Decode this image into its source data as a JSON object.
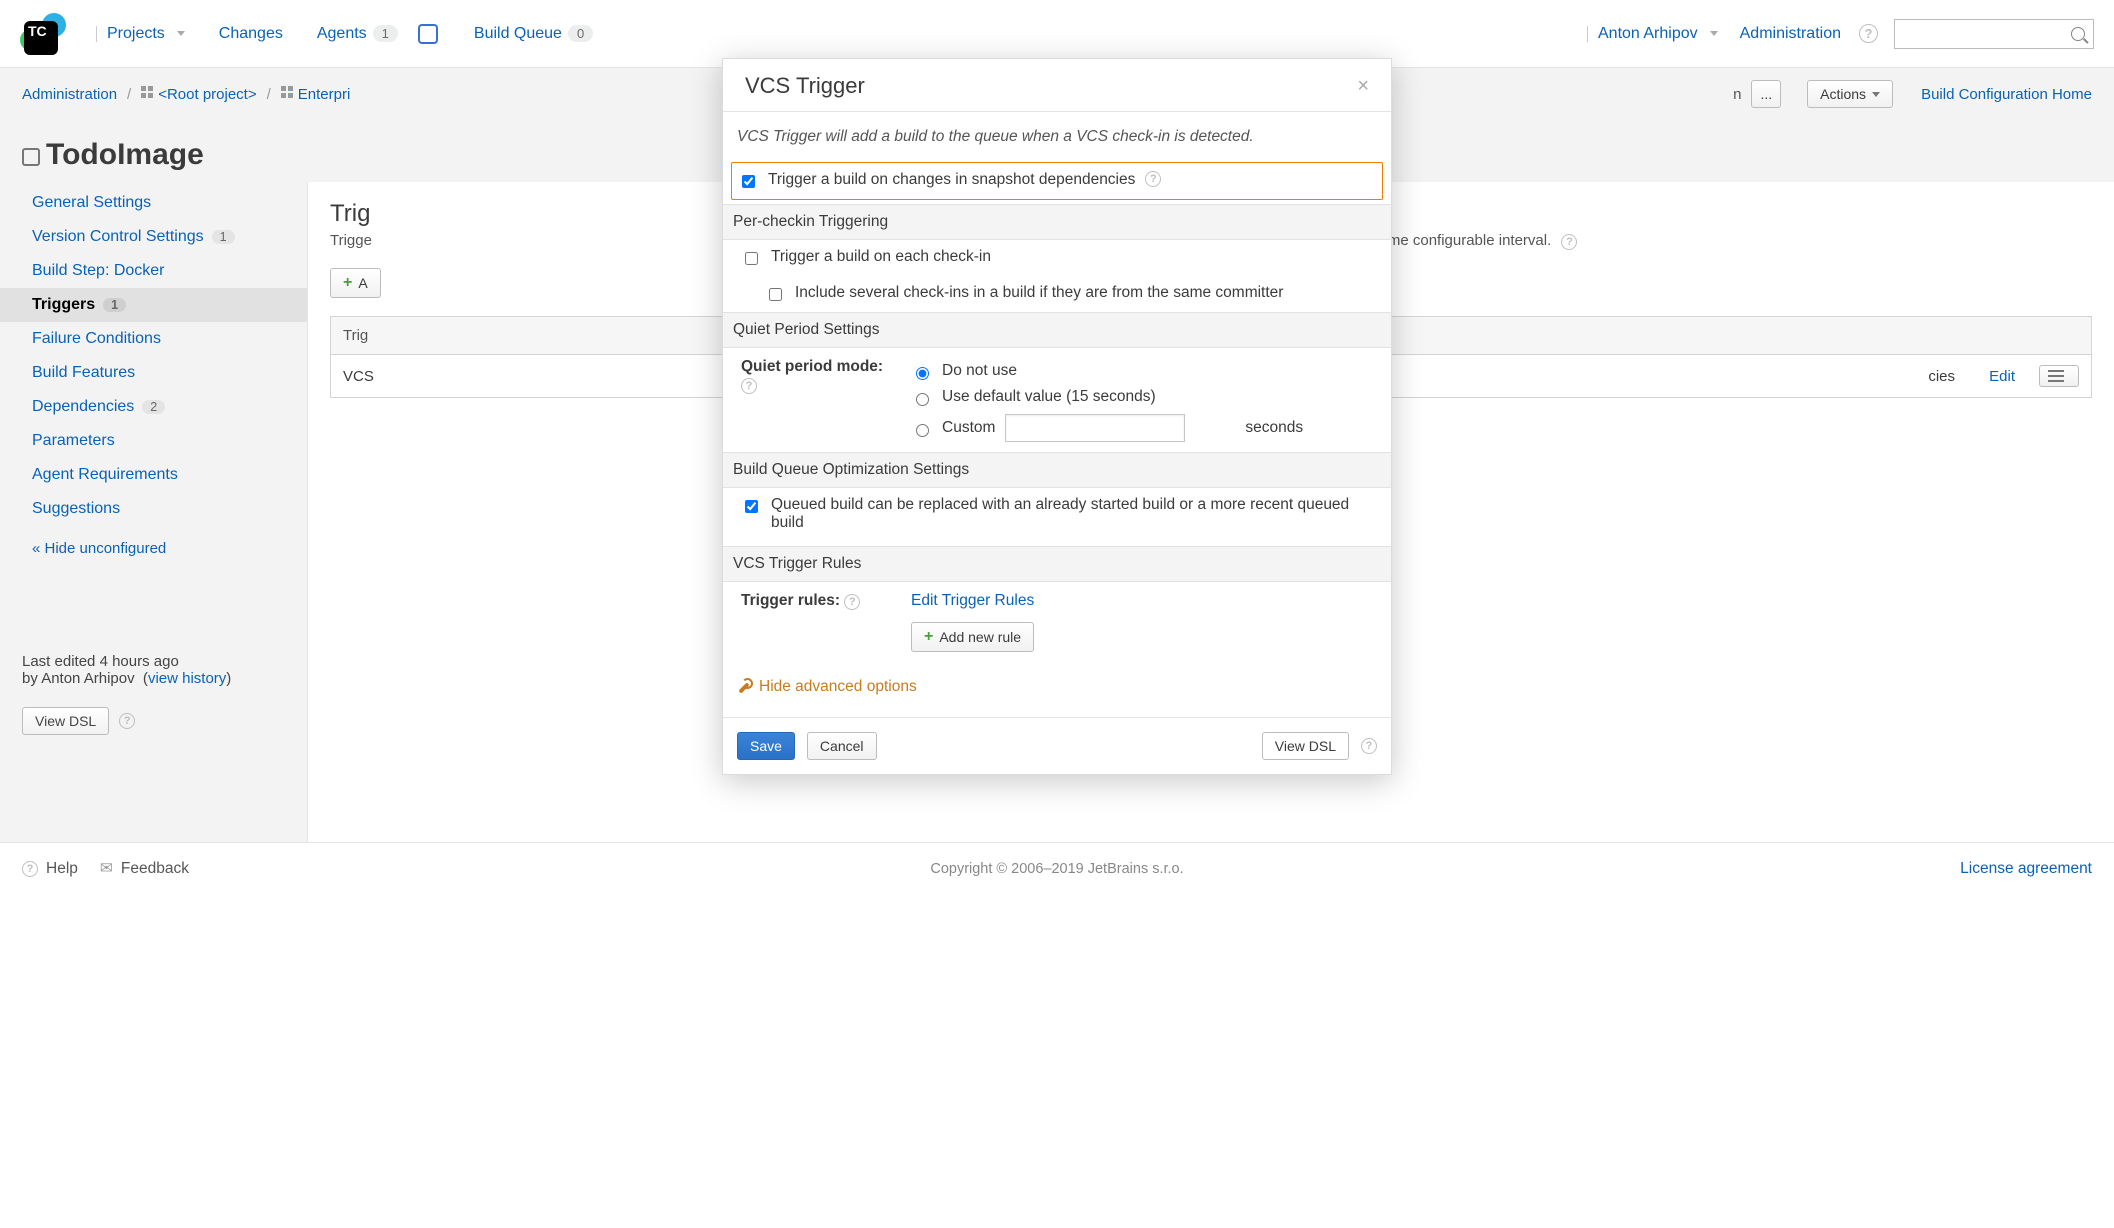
{
  "topbar": {
    "projects": "Projects",
    "changes": "Changes",
    "agents": "Agents",
    "agents_badge": "1",
    "buildqueue": "Build Queue",
    "buildqueue_badge": "0",
    "user": "Anton Arhipov",
    "admin": "Administration"
  },
  "crumbs": {
    "c0": "Administration",
    "c1": "<Root project>",
    "c2": "Enterpri",
    "ellipsis": "...",
    "actions": "Actions",
    "home": "Build Configuration Home",
    "hidden_ch": "n"
  },
  "page": {
    "title": "TodoImage"
  },
  "sidebar": {
    "items": [
      {
        "label": "General Settings"
      },
      {
        "label": "Version Control Settings",
        "badge": "1"
      },
      {
        "label": "Build Step: Docker"
      },
      {
        "label": "Triggers",
        "badge": "1",
        "active": true
      },
      {
        "label": "Failure Conditions"
      },
      {
        "label": "Build Features"
      },
      {
        "label": "Dependencies",
        "badge": "2"
      },
      {
        "label": "Parameters"
      },
      {
        "label": "Agent Requirements"
      },
      {
        "label": "Suggestions"
      }
    ],
    "hide_unconfigured": "« Hide unconfigured"
  },
  "meta": {
    "edited_label": "Last edited",
    "edited_when": "4 hours ago",
    "by": "by",
    "author": "Anton Arhipov",
    "view_history": "view history",
    "view_dsl": "View DSL"
  },
  "main": {
    "heading_cut": "Trig",
    "sub_cut": "Trigge",
    "add_btn": "A",
    "sub_tail": "dically with some configurable interval.",
    "th_trigger_cut": "Trig",
    "td_trigger_cut": "VCS",
    "td_param_tail": "cies",
    "edit": "Edit"
  },
  "footer": {
    "help": "Help",
    "feedback": "Feedback",
    "license": "License agreement",
    "copyright": "Copyright © 2006–2019 JetBrains s.r.o."
  },
  "modal": {
    "title": "VCS Trigger",
    "desc": "VCS Trigger will add a build to the queue when a VCS check-in is detected.",
    "chk_snapshot": "Trigger a build on changes in snapshot dependencies",
    "section_percheckin": "Per-checkin Triggering",
    "chk_each": "Trigger a build on each check-in",
    "chk_include": "Include several check-ins in a build if they are from the same committer",
    "section_quiet": "Quiet Period Settings",
    "quiet_label": "Quiet period mode:",
    "r_none": "Do not use",
    "r_default": "Use default value (15 seconds)",
    "r_custom": "Custom",
    "r_custom_suffix": "seconds",
    "section_bq": "Build Queue Optimization Settings",
    "chk_replace": "Queued build can be replaced with an already started build or a more recent queued build",
    "section_rules": "VCS Trigger Rules",
    "rules_label": "Trigger rules:",
    "edit_rules": "Edit Trigger Rules",
    "add_rule": "Add new rule",
    "hide_adv": "Hide advanced options",
    "save": "Save",
    "cancel": "Cancel",
    "view_dsl": "View DSL"
  }
}
